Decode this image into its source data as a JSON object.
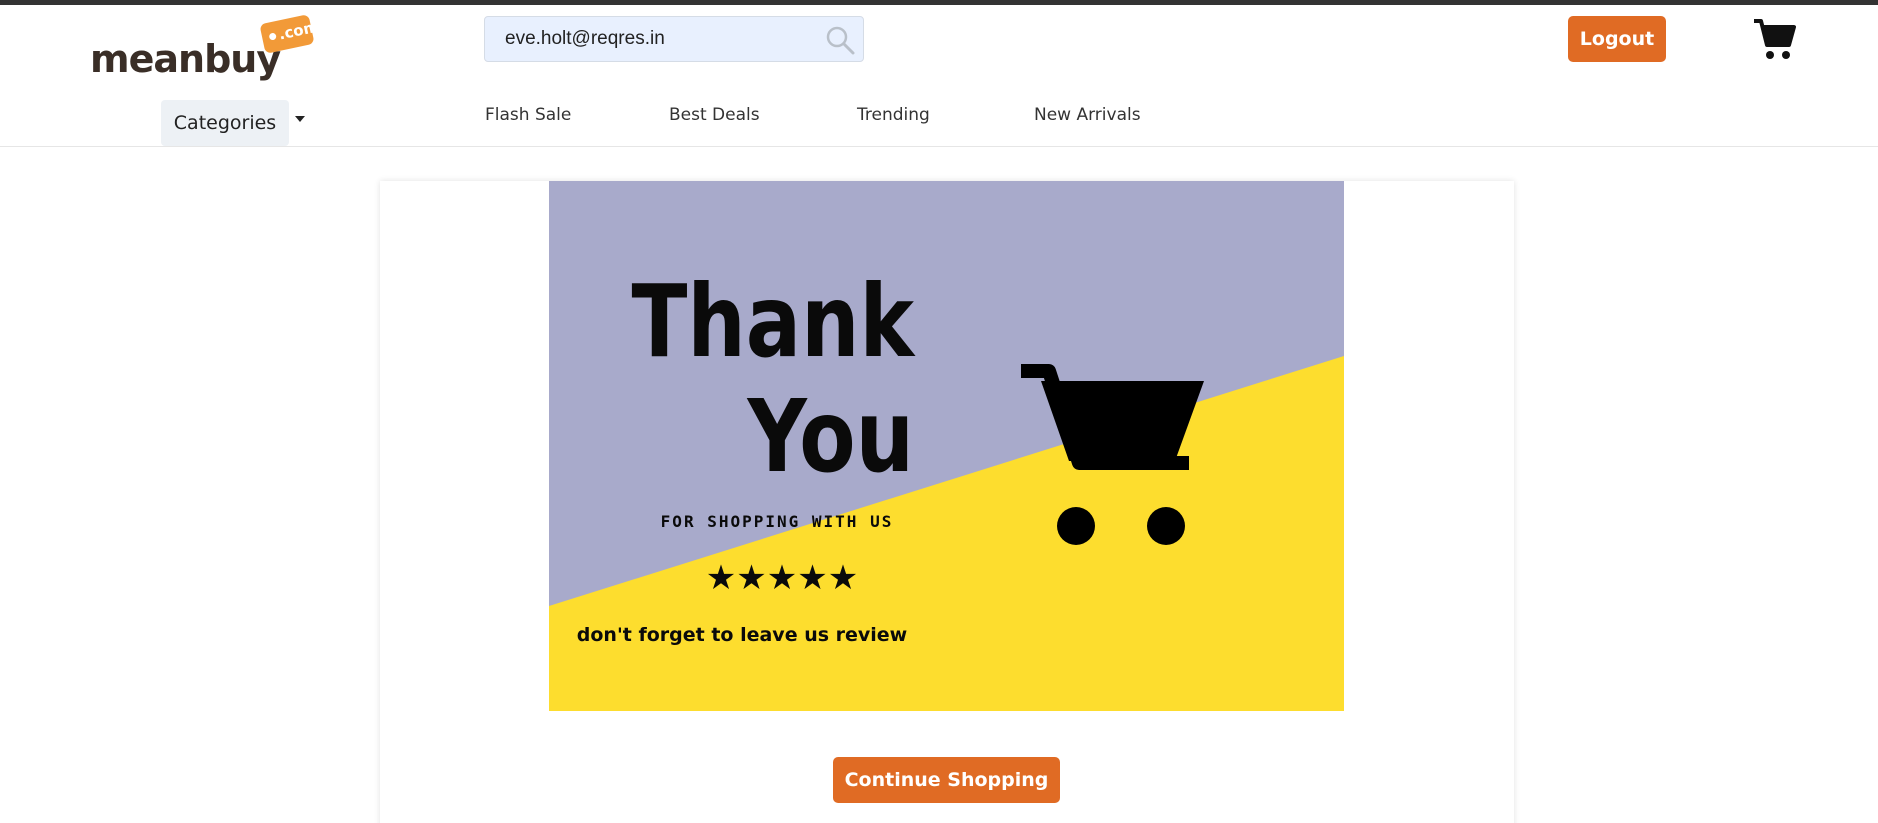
{
  "header": {
    "logo": {
      "brand": "meanbuy",
      "tag": ".com"
    },
    "search": {
      "value": "eve.holt@reqres.in",
      "placeholder": ""
    },
    "logout_label": "Logout",
    "categories_label": "Categories",
    "nav": [
      {
        "label": "Flash Sale"
      },
      {
        "label": "Best Deals"
      },
      {
        "label": "Trending"
      },
      {
        "label": "New Arrivals"
      }
    ]
  },
  "banner": {
    "line1": "Thank",
    "line2": "You",
    "subline": "FOR SHOPPING WITH US",
    "stars": "★★★★★",
    "footer": "don't forget to leave us  review",
    "colors": {
      "top": "#a8aacb",
      "bottom": "#fddd2e"
    }
  },
  "actions": {
    "continue_label": "Continue Shopping"
  },
  "theme": {
    "accent": "#e06b24"
  }
}
